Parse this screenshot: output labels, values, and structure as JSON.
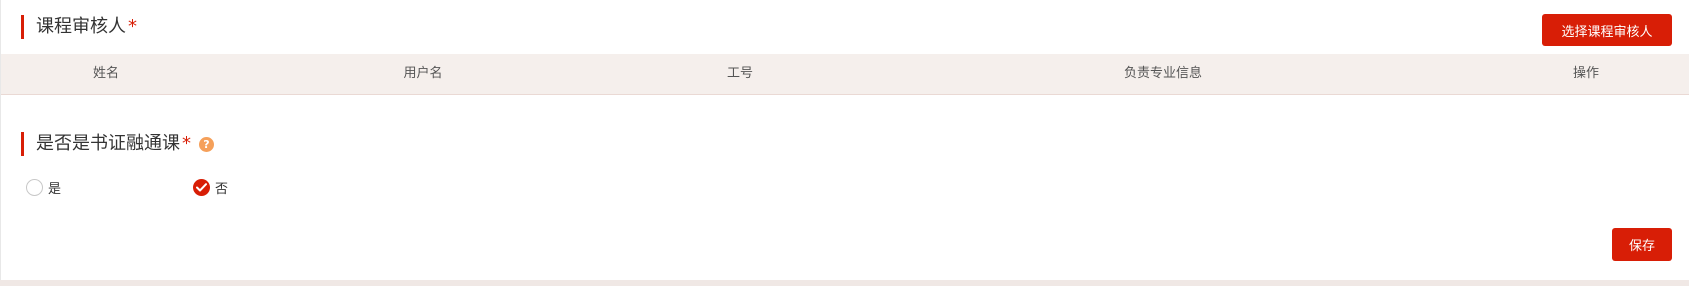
{
  "reviewer_section": {
    "title": "课程审核人",
    "required_mark": "*",
    "select_button_label": "选择课程审核人",
    "table_headers": [
      "姓名",
      "用户名",
      "工号",
      "负责专业信息",
      "操作"
    ]
  },
  "cert_section": {
    "title": "是否是书证融通课",
    "required_mark": "*",
    "help_icon_glyph": "?",
    "options": [
      {
        "label": "是",
        "checked": false
      },
      {
        "label": "否",
        "checked": true
      }
    ]
  },
  "actions": {
    "save_label": "保存"
  },
  "colors": {
    "accent": "#d81e06",
    "table_header_bg": "#f5efec",
    "help_icon": "#f5a05a"
  }
}
